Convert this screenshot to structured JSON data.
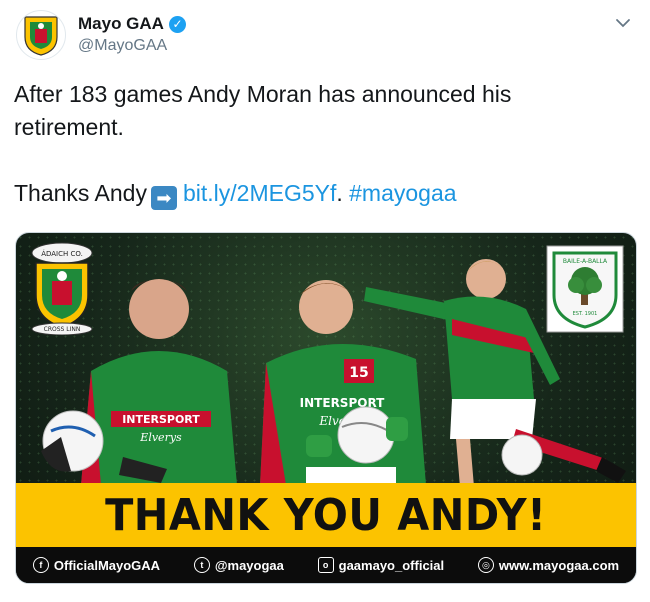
{
  "author": {
    "name": "Mayo GAA",
    "handle": "@MayoGAA",
    "verified": true,
    "avatar_icon": "mayo-crest-icon"
  },
  "tweet": {
    "line1": "After 183 games Andy Moran has announced his",
    "line2": "retirement.",
    "line3_prefix": "Thanks Andy",
    "arrow_emoji": "➡",
    "link": "bit.ly/2MEG5Yf",
    "separator": ". ",
    "hashtag": "#mayogaa"
  },
  "media": {
    "banner_text": "THANK YOU ANDY!",
    "banner_color": "#fcc300",
    "jersey_number": "15",
    "sponsor_text": "INTERSPORT",
    "sponsor_sub": "Elverys",
    "crest_left_top": "ÁDAICH CO.",
    "crest_left_bottom": "CROSS LINN",
    "crest_right_top": "BAILE-A-BALLA",
    "crest_right_bottom": "EST. 1901",
    "footer": [
      {
        "icon": "facebook-icon",
        "label": "OfficialMayoGAA"
      },
      {
        "icon": "twitter-icon",
        "label": "@mayogaa"
      },
      {
        "icon": "instagram-icon",
        "label": "gaamayo_official"
      },
      {
        "icon": "globe-icon",
        "label": "www.mayogaa.com"
      }
    ]
  },
  "colors": {
    "link": "#1b95e0",
    "mayo_green": "#1f8a3a",
    "mayo_red": "#c8102e"
  }
}
